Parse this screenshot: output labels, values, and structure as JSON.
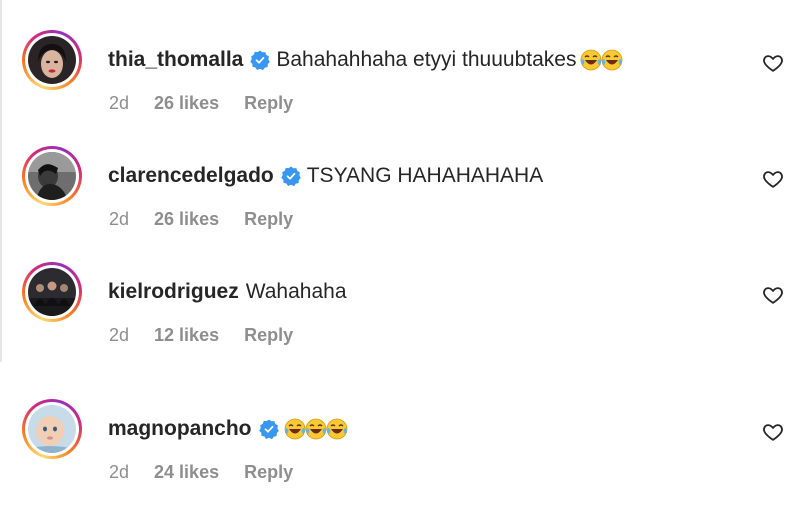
{
  "colors": {
    "verified_badge": "#3897f0",
    "meta_text": "#8e8e8e",
    "primary_text": "#262626"
  },
  "comments": [
    {
      "username": "thia_thomalla",
      "verified": true,
      "text": "Bahahahhaha etyyi thuuubtakes",
      "emoji": "😂😂",
      "time": "2d",
      "likes": "26 likes",
      "reply": "Reply",
      "avatar": "woman-portrait"
    },
    {
      "username": "clarencedelgado",
      "verified": true,
      "text": "TSYANG HAHAHAHAHA",
      "emoji": "",
      "time": "2d",
      "likes": "26 likes",
      "reply": "Reply",
      "avatar": "man-mono-photo"
    },
    {
      "username": "kielrodriguez",
      "verified": false,
      "text": "Wahahaha",
      "emoji": "",
      "time": "2d",
      "likes": "12 likes",
      "reply": "Reply",
      "avatar": "group-photo"
    },
    {
      "username": "magnopancho",
      "verified": true,
      "text": "",
      "emoji": "😂😂😂",
      "time": "2d",
      "likes": "24 likes",
      "reply": "Reply",
      "avatar": "baby-photo"
    }
  ]
}
